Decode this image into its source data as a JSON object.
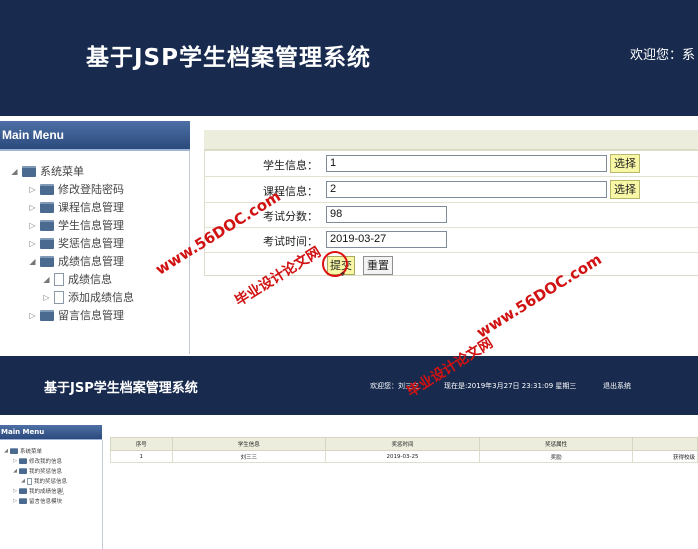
{
  "top": {
    "header": {
      "title": "基于JSP学生档案管理系统",
      "welcome": "欢迎您：系"
    },
    "menu": {
      "heading": "Main Menu",
      "items": [
        {
          "label": "系统菜单",
          "level": 0,
          "expanded": true
        },
        {
          "label": "修改登陆密码",
          "level": 1,
          "expanded": false
        },
        {
          "label": "课程信息管理",
          "level": 1,
          "expanded": false
        },
        {
          "label": "学生信息管理",
          "level": 1,
          "expanded": false
        },
        {
          "label": "奖惩信息管理",
          "level": 1,
          "expanded": false
        },
        {
          "label": "成绩信息管理",
          "level": 1,
          "expanded": true
        },
        {
          "label": "成绩信息",
          "level": 2,
          "expanded": true
        },
        {
          "label": "添加成绩信息",
          "level": 2,
          "expanded": false
        },
        {
          "label": "留言信息管理",
          "level": 1,
          "expanded": false
        }
      ]
    },
    "form": {
      "fields": [
        {
          "label": "学生信息：",
          "value": "1",
          "choose": "选择"
        },
        {
          "label": "课程信息：",
          "value": "2",
          "choose": "选择"
        },
        {
          "label": "考试分数：",
          "value": "98"
        },
        {
          "label": "考试时间：",
          "value": "2019-03-27"
        }
      ],
      "submit": "提交",
      "reset": "重置"
    }
  },
  "bottom": {
    "header": {
      "title": "基于JSP学生档案管理系统",
      "welcome": "欢迎您：刘三三",
      "time": "现在是:2019年3月27日 23:31:09 星期三",
      "logout": "退出系统"
    },
    "menu": {
      "heading": "Main Menu",
      "items": [
        {
          "label": "系统菜单",
          "level": 0
        },
        {
          "label": "修改我的信息",
          "level": 1
        },
        {
          "label": "我的奖惩信息",
          "level": 1
        },
        {
          "label": "我的奖惩信息",
          "level": 2
        },
        {
          "label": "我的成绩信息",
          "level": 1
        },
        {
          "label": "留言信息模块",
          "level": 1
        }
      ]
    },
    "table": {
      "columns": [
        "序号",
        "学生信息",
        "奖惩时间",
        "奖惩属性",
        ""
      ],
      "rows": [
        [
          "1",
          "刘三三",
          "2019-03-25",
          "奖励",
          "获得校级"
        ]
      ]
    }
  },
  "watermarks": {
    "url": "www.56DOC.com",
    "text": "毕业设计论文网"
  },
  "colors": {
    "header": "#182b4e",
    "form_bg": "#eceddc",
    "choose_btn": "#f7f7a6",
    "watermark": "#d11212"
  }
}
